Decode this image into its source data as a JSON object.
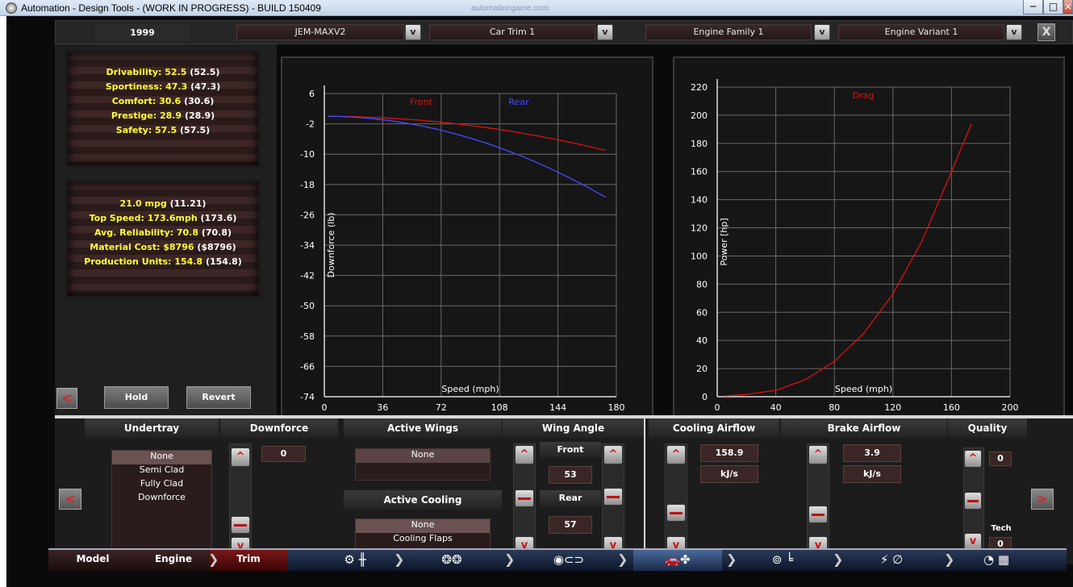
{
  "window": {
    "title": "Automation - Design Tools - (WORK IN PROGRESS) - BUILD 150409",
    "ghost_tab": "automationgame.com",
    "min": "─",
    "max": "□",
    "close": "×"
  },
  "top": {
    "year": "1999",
    "model": "JEM-MAXV2",
    "trim": "Car Trim 1",
    "engine_family": "Engine Family 1",
    "engine_variant": "Engine Variant 1",
    "dd_arrow": "v",
    "close": "X"
  },
  "stats1": [
    {
      "label": "Drivability: 52.5",
      "par": "(52.5)"
    },
    {
      "label": "Sportiness: 47.3",
      "par": "(47.3)"
    },
    {
      "label": "Comfort: 30.6",
      "par": "(30.6)"
    },
    {
      "label": "Prestige: 28.9",
      "par": "(28.9)"
    },
    {
      "label": "Safety: 57.5",
      "par": "(57.5)"
    }
  ],
  "stats2": [
    {
      "label": "21.0 mpg",
      "par": "(11.21)"
    },
    {
      "label": "Top Speed: 173.6mph",
      "par": "(173.6)"
    },
    {
      "label": "Avg. Reliability: 70.8",
      "par": "(70.8)"
    },
    {
      "label": "Material Cost: $8796",
      "par": "($8796)"
    },
    {
      "label": "Production Units: 154.8",
      "par": "(154.8)"
    }
  ],
  "buttons": {
    "hold": "Hold",
    "revert": "Revert",
    "back": "<",
    "prev": "<",
    "next": ">",
    "up": "^",
    "down": "v"
  },
  "chart_data": [
    {
      "type": "line",
      "xlabel": "Speed (mph)",
      "ylabel": "Downforce (lb)",
      "xlim": [
        0,
        180
      ],
      "ylim": [
        -74,
        6
      ],
      "xticks": [
        "0",
        "36",
        "72",
        "108",
        "144",
        "180"
      ],
      "yticks": [
        "6",
        "-2",
        "-10",
        "-18",
        "-26",
        "-34",
        "-42",
        "-50",
        "-58",
        "-66",
        "-74"
      ],
      "legend_placement": "top",
      "series": [
        {
          "name": "Front",
          "color": "#dd1111",
          "x": [
            2,
            10,
            20,
            30,
            40,
            50,
            60,
            70,
            80,
            90,
            100,
            110,
            120,
            130,
            140,
            150,
            160,
            170,
            173.6
          ],
          "y": [
            0,
            -0.03,
            -0.12,
            -0.27,
            -0.48,
            -0.75,
            -1.08,
            -1.47,
            -1.92,
            -2.43,
            -3.0,
            -3.63,
            -4.32,
            -5.07,
            -5.88,
            -6.75,
            -7.68,
            -8.67,
            -9.0
          ]
        },
        {
          "name": "Rear",
          "color": "#4848ff",
          "x": [
            2,
            10,
            20,
            30,
            40,
            50,
            60,
            70,
            80,
            90,
            100,
            110,
            120,
            130,
            140,
            150,
            160,
            170,
            173.6
          ],
          "y": [
            0,
            -0.07,
            -0.28,
            -0.64,
            -1.14,
            -1.78,
            -2.56,
            -3.48,
            -4.55,
            -5.76,
            -7.11,
            -8.6,
            -10.24,
            -12.02,
            -13.94,
            -16.0,
            -18.2,
            -20.55,
            -21.4
          ]
        }
      ],
      "grid": true
    },
    {
      "type": "line",
      "xlabel": "Speed (mph)",
      "ylabel": "Power [hp]",
      "xlim": [
        0,
        200
      ],
      "ylim": [
        0,
        220
      ],
      "xticks": [
        "0",
        "40",
        "80",
        "120",
        "160",
        "200"
      ],
      "yticks": [
        "220",
        "200",
        "180",
        "160",
        "140",
        "120",
        "100",
        "80",
        "60",
        "40",
        "20",
        "0"
      ],
      "legend_placement": "top",
      "series": [
        {
          "name": "Drag",
          "color": "#dd1111",
          "x": [
            5,
            20,
            40,
            60,
            80,
            100,
            120,
            140,
            160,
            173.6
          ],
          "y": [
            0.5,
            1.6,
            4.6,
            12,
            25,
            45,
            73,
            111,
            160,
            194
          ]
        }
      ],
      "grid": true
    }
  ],
  "bottom": {
    "undertray": {
      "title": "Undertray",
      "options": [
        "None",
        "Semi Clad",
        "Fully Clad",
        "Downforce"
      ],
      "selected": "None"
    },
    "downforce": {
      "title": "Downforce",
      "value": "0"
    },
    "active_wings": {
      "title": "Active Wings",
      "value": "None"
    },
    "active_cooling": {
      "title": "Active Cooling",
      "options": [
        "None",
        "Cooling Flaps"
      ],
      "selected": "None"
    },
    "wing_angle": {
      "title": "Wing Angle",
      "front_label": "Front",
      "front_value": "53",
      "rear_label": "Rear",
      "rear_value": "57"
    },
    "cooling_airflow": {
      "title": "Cooling Airflow",
      "value": "158.9",
      "unit": "kJ/s"
    },
    "brake_airflow": {
      "title": "Brake Airflow",
      "value": "3.9",
      "unit": "kJ/s"
    },
    "quality": {
      "title": "Quality",
      "value": "0",
      "tech_label": "Tech",
      "tech_value": "0"
    }
  },
  "nav": {
    "model": "Model",
    "engine": "Engine",
    "trim": "Trim",
    "icon_chassis": "⚙ ╫",
    "icon_wheels": "❂❂",
    "icon_body": "◉⊂⊃",
    "icon_car": "🚗✤",
    "icon_interior": "⊚ ╘",
    "icon_safety": "⚡ ∅",
    "icon_test": "◔ ▦",
    "chev": "❯"
  }
}
